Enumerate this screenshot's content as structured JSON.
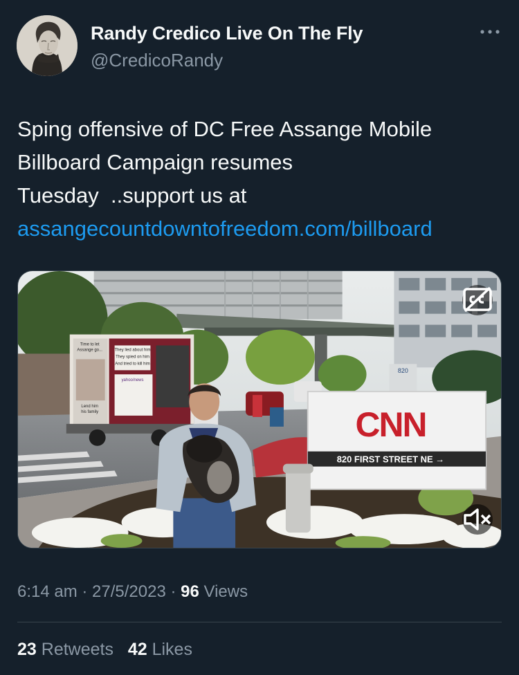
{
  "author": {
    "name": "Randy Credico Live On The Fly",
    "handle": "@CredicoRandy",
    "more_icon": "ellipsis-icon"
  },
  "tweet": {
    "text_lines": [
      "Sping offensive of DC Free Assange Mobile",
      "Billboard Campaign resumes",
      "Tuesday  ..support us at"
    ],
    "link": "assangecountdowntofreedom.com/billboard"
  },
  "media": {
    "billboard_truck_texts": [
      "Time to let",
      "Assange go...",
      "They lied about him",
      "They spied on him",
      "And tried to kill him",
      "yahoo/news",
      "Lend him",
      "his family"
    ],
    "cnn_sign": {
      "logo": "CNN",
      "address": "820 FIRST STREET NE →"
    },
    "building_number": "820",
    "cc_icon": "captions-icon",
    "mute_icon": "muted-speaker-icon"
  },
  "meta": {
    "time": "6:14 am",
    "separator": " · ",
    "date": "27/5/2023",
    "views_count": "96",
    "views_label": " Views"
  },
  "stats": {
    "retweets_count": "23",
    "retweets_label": " Retweets",
    "likes_count": "42",
    "likes_label": " Likes"
  },
  "colors": {
    "background": "#15202b",
    "link": "#1d9bf0",
    "secondary_text": "#8b98a5",
    "primary_text": "#f7f9f9",
    "divider": "#38444d"
  }
}
